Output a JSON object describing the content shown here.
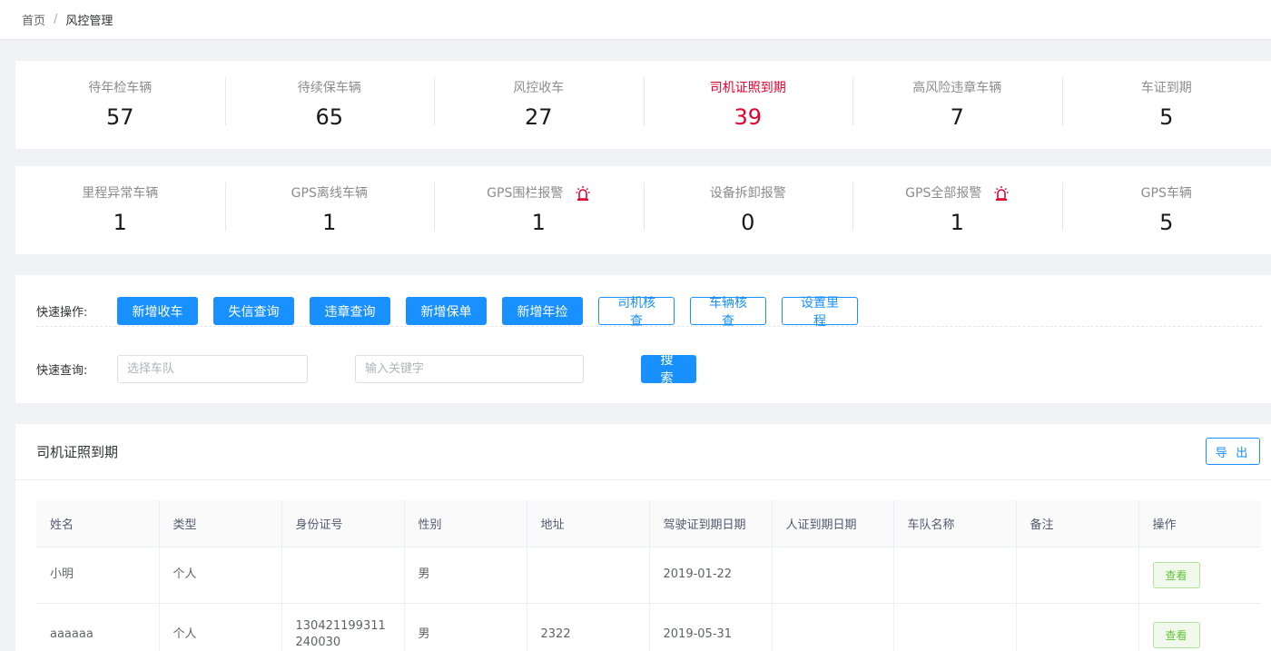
{
  "breadcrumb": {
    "home": "首页",
    "separator": "/",
    "current": "风控管理"
  },
  "stats_row1": [
    {
      "label": "待年检车辆",
      "value": "57"
    },
    {
      "label": "待续保车辆",
      "value": "65"
    },
    {
      "label": "风控收车",
      "value": "27"
    },
    {
      "label": "司机证照到期",
      "value": "39",
      "alert": true
    },
    {
      "label": "高风险违章车辆",
      "value": "7"
    },
    {
      "label": "车证到期",
      "value": "5"
    }
  ],
  "stats_row2": [
    {
      "label": "里程异常车辆",
      "value": "1"
    },
    {
      "label": "GPS离线车辆",
      "value": "1"
    },
    {
      "label": "GPS围栏报警",
      "value": "1",
      "icon": "alarm-icon"
    },
    {
      "label": "设备拆卸报警",
      "value": "0"
    },
    {
      "label": "GPS全部报警",
      "value": "1",
      "icon": "alarm-icon"
    },
    {
      "label": "GPS车辆",
      "value": "5"
    }
  ],
  "quick_ops": {
    "label": "快速操作:",
    "primary_buttons": [
      "新增收车",
      "失信查询",
      "违章查询",
      "新增保单",
      "新增年捡"
    ],
    "plain_buttons": [
      "司机核查",
      "车辆核查",
      "设置里程"
    ]
  },
  "quick_query": {
    "label": "快速查询:",
    "team_placeholder": "选择车队",
    "keyword_placeholder": "输入关键字",
    "search_label": "搜 索"
  },
  "table": {
    "title": "司机证照到期",
    "export_label": "导 出",
    "columns": [
      "姓名",
      "类型",
      "身份证号",
      "性别",
      "地址",
      "驾驶证到期日期",
      "人证到期日期",
      "车队名称",
      "备注",
      "操作"
    ],
    "rows": [
      {
        "name": "小明",
        "type": "个人",
        "id_no": "",
        "gender": "男",
        "address": "",
        "license_expiry": "2019-01-22",
        "person_expiry": "",
        "team": "",
        "remark": "",
        "action": "查看"
      },
      {
        "name": "aaaaaa",
        "type": "个人",
        "id_no": "130421199311240030",
        "gender": "男",
        "address": "2322",
        "license_expiry": "2019-05-31",
        "person_expiry": "",
        "team": "",
        "remark": "",
        "action": "查看"
      }
    ]
  },
  "colors": {
    "primary": "#1890ff",
    "alert": "#e8002d",
    "success": "#67c23a"
  }
}
